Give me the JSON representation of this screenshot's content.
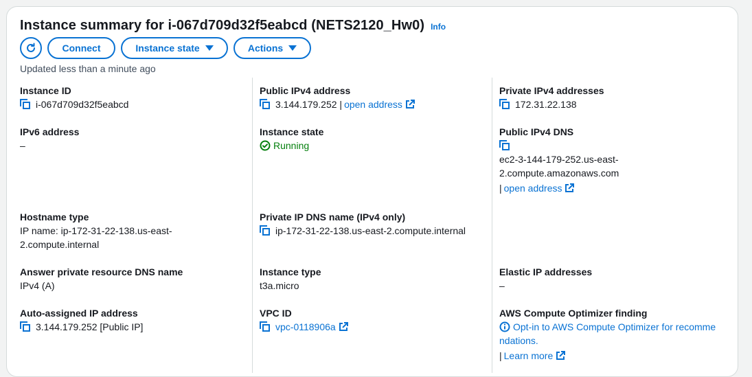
{
  "header": {
    "title": "Instance summary for i-067d709d32f5eabcd (NETS2120_Hw0)",
    "info_label": "Info"
  },
  "toolbar": {
    "connect_label": "Connect",
    "instance_state_label": "Instance state",
    "actions_label": "Actions"
  },
  "updated_text": "Updated less than a minute ago",
  "fields": {
    "instance_id": {
      "label": "Instance ID",
      "value": "i-067d709d32f5eabcd"
    },
    "public_ipv4": {
      "label": "Public IPv4 address",
      "value": "3.144.179.252",
      "link": "open address"
    },
    "private_ipv4": {
      "label": "Private IPv4 addresses",
      "value": "172.31.22.138"
    },
    "ipv6": {
      "label": "IPv6 address",
      "value": "–"
    },
    "instance_state": {
      "label": "Instance state",
      "value": "Running"
    },
    "public_dns": {
      "label": "Public IPv4 DNS",
      "value_line1": "ec2-3-144-179-252.us-east-",
      "value_line2": "2.compute.amazonaws.com",
      "link": "open address"
    },
    "hostname_type": {
      "label": "Hostname type",
      "value_line1": "IP name: ip-172-31-22-138.us-east-",
      "value_line2": "2.compute.internal"
    },
    "private_dns": {
      "label": "Private IP DNS name (IPv4 only)",
      "value": "ip-172-31-22-138.us-east-2.compute.internal"
    },
    "answer_dns": {
      "label": "Answer private resource DNS name",
      "value": "IPv4 (A)"
    },
    "instance_type": {
      "label": "Instance type",
      "value": "t3a.micro"
    },
    "elastic_ip": {
      "label": "Elastic IP addresses",
      "value": "–"
    },
    "auto_ip": {
      "label": "Auto-assigned IP address",
      "value": "3.144.179.252 [Public IP]"
    },
    "vpc_id": {
      "label": "VPC ID",
      "value": "vpc-0118906a"
    },
    "optimizer": {
      "label": "AWS Compute Optimizer finding",
      "value_line1": "Opt-in to AWS Compute Optimizer for recomme",
      "value_line2": "ndations.",
      "link": "Learn more"
    }
  },
  "colors": {
    "link": "#0972d3",
    "success": "#037f0c",
    "border": "#d5dbdb"
  }
}
